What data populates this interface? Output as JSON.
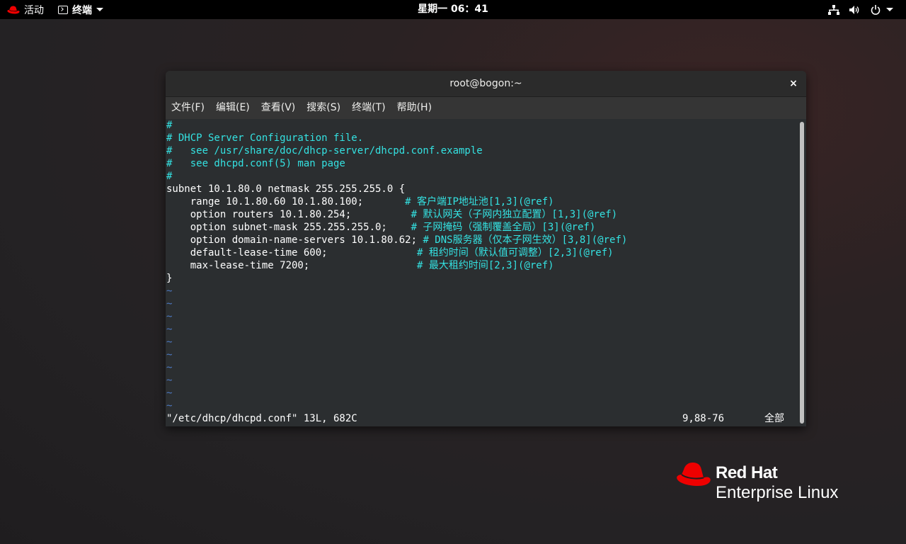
{
  "topbar": {
    "activities_label": "活动",
    "app_label": "终端",
    "clock": "星期一 06：41",
    "tray_icons": [
      "network-icon",
      "volume-icon",
      "power-icon"
    ]
  },
  "window": {
    "title": "root@bogon:~",
    "close_label": "×",
    "menu": [
      "文件(F)",
      "编辑(E)",
      "查看(V)",
      "搜索(S)",
      "终端(T)",
      "帮助(H)"
    ]
  },
  "terminal": {
    "lines": [
      {
        "code": "",
        "comment": "#"
      },
      {
        "code": "",
        "comment": "# DHCP Server Configuration file."
      },
      {
        "code": "",
        "comment": "#   see /usr/share/doc/dhcp-server/dhcpd.conf.example"
      },
      {
        "code": "",
        "comment": "#   see dhcpd.conf(5) man page"
      },
      {
        "code": "",
        "comment": "#"
      },
      {
        "code": "subnet 10.1.80.0 netmask 255.255.255.0 {",
        "comment": ""
      },
      {
        "code": "    range 10.1.80.60 10.1.80.100;       ",
        "comment": "# 客户端IP地址池[1,3](@ref)"
      },
      {
        "code": "    option routers 10.1.80.254;          ",
        "comment": "# 默认网关（子网内独立配置）[1,3](@ref)"
      },
      {
        "code": "    option subnet-mask 255.255.255.0;    ",
        "comment": "# 子网掩码（强制覆盖全局）[3](@ref)"
      },
      {
        "code": "    option domain-name-servers 10.1.80.62; ",
        "comment": "# DNS服务器（仅本子网生效）[3,8](@ref)"
      },
      {
        "code": "    default-lease-time 600;               ",
        "comment": "# 租约时间（默认值可调整）[2,3](@ref)"
      },
      {
        "code": "    max-lease-time 7200;                  ",
        "comment": "# 最大租约时间[2,3](@ref)"
      },
      {
        "code": "}",
        "comment": ""
      }
    ],
    "tilde_lines": [
      "~",
      "~",
      "~",
      "~",
      "~",
      "~",
      "~",
      "~",
      "~",
      "~"
    ],
    "status_file": "\"/etc/dhcp/dhcpd.conf\" 13L, 682C",
    "status_position": "9,88-76",
    "status_scroll": "全部"
  },
  "branding": {
    "name": "Red Hat",
    "product": "Enterprise Linux"
  },
  "colors": {
    "comment": "#34e2e2",
    "tilde": "#4d79c4",
    "redhat_red": "#ee0000"
  }
}
